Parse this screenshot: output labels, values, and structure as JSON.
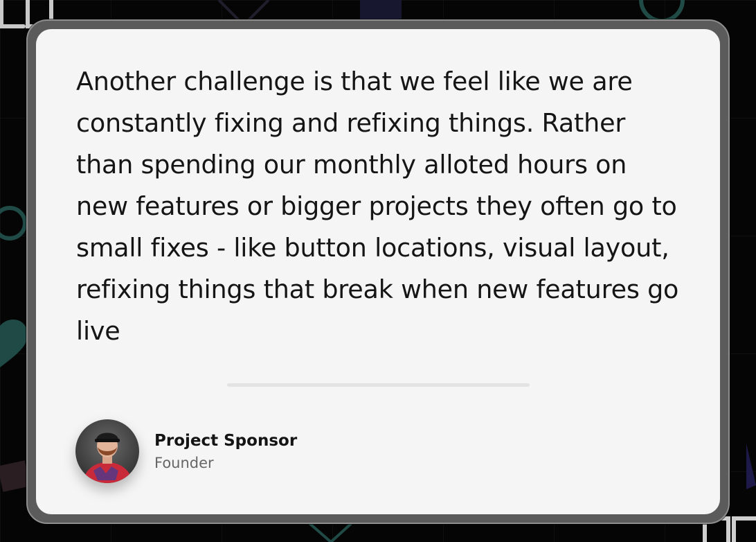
{
  "testimonial": {
    "quote": "Another challenge is that we feel like we are constantly fixing and refixing things. Rather than spending our monthly alloted hours on new features or bigger projects they often go to small fixes - like button locations, visual layout, refixing things that break when new features go live",
    "author": {
      "name": "Project Sponsor",
      "role": "Founder"
    }
  },
  "colors": {
    "page_background": "#050505",
    "card_background": "#f5f5f5",
    "card_frame": "#5b5b5b",
    "text_primary": "#151515",
    "text_secondary": "#666666",
    "accent_teal": "#1f4a45"
  },
  "icons": {
    "decorative": [
      "heart-icon",
      "circle-outline-icon",
      "square-outline-icon",
      "triangle-icon"
    ]
  }
}
